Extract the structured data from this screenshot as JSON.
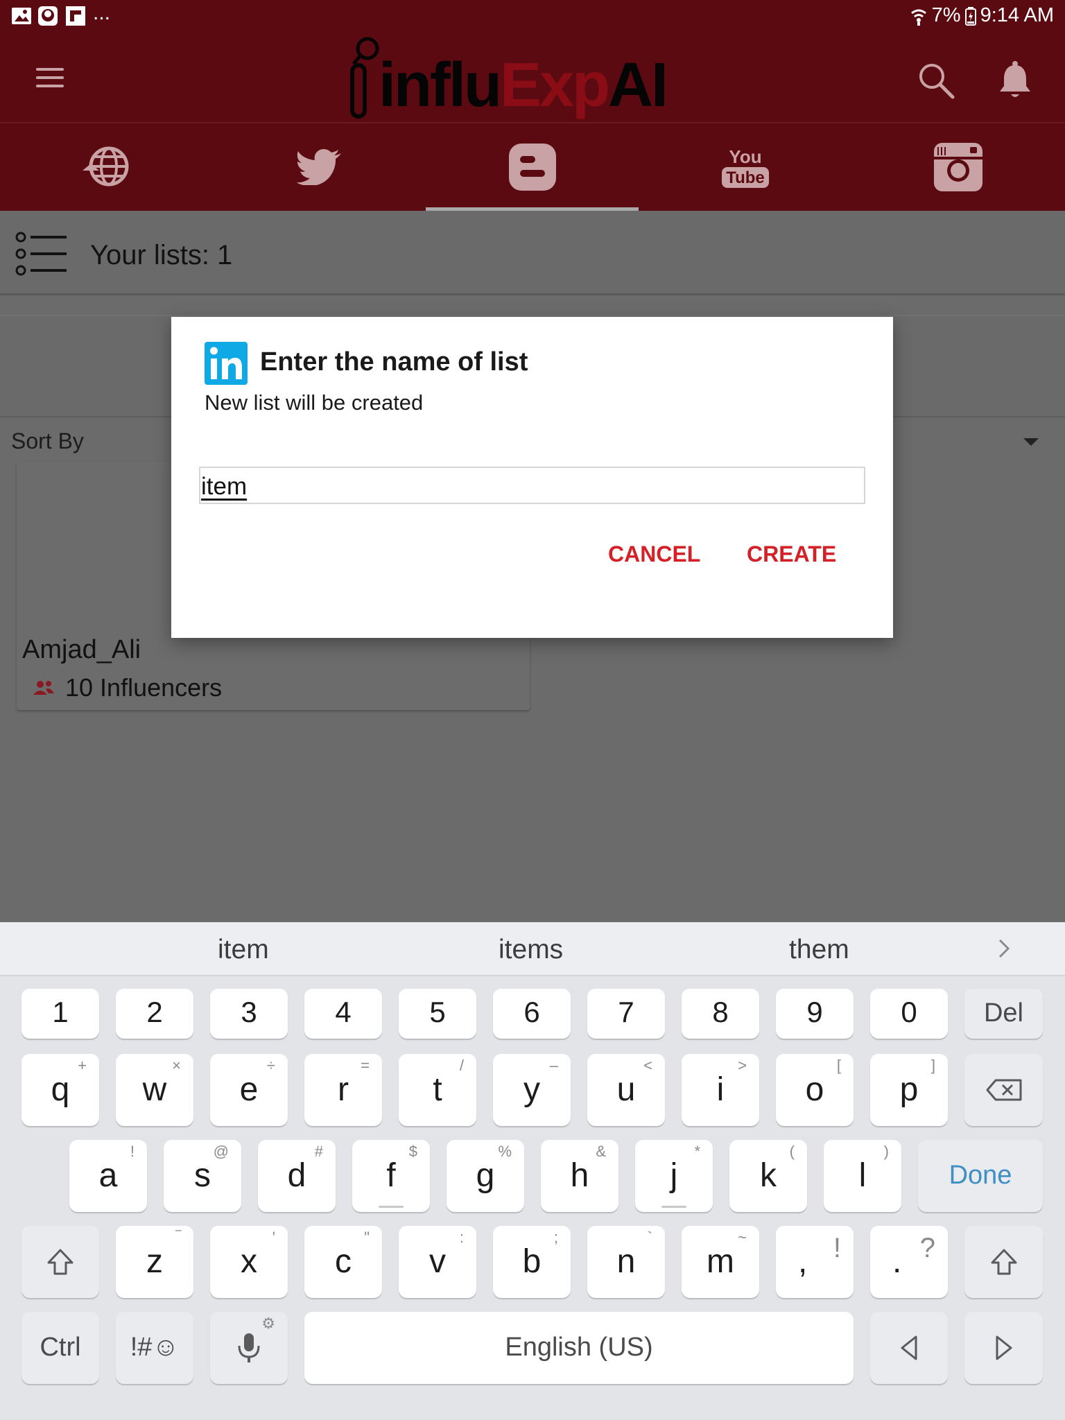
{
  "status_bar": {
    "overflow_dots": "...",
    "battery_percent": "7%",
    "time": "9:14 AM",
    "icons": [
      "gallery-icon",
      "app-notification-icon",
      "flipboard-icon",
      "wifi-icon",
      "battery-icon"
    ]
  },
  "app_bar": {
    "logo_part1": "influ",
    "logo_part2": "Exp",
    "logo_part3": "AI",
    "icons": [
      "hamburger-menu-icon",
      "search-icon",
      "bell-icon"
    ]
  },
  "tabs": [
    {
      "name": "web",
      "icon": "globe-icon"
    },
    {
      "name": "twitter",
      "icon": "twitter-icon",
      "active": false
    },
    {
      "name": "blogger",
      "icon": "blogger-icon",
      "active": true
    },
    {
      "name": "youtube",
      "icon": "youtube-icon",
      "label_top": "You",
      "label_bottom": "Tube"
    },
    {
      "name": "instagram",
      "icon": "instagram-icon"
    }
  ],
  "content": {
    "lists_title": "Your lists: 1",
    "sort_by_label": "Sort By",
    "list_card": {
      "name": "Amjad_Ali",
      "count": "10 Influencers"
    }
  },
  "dialog": {
    "title": "Enter the name of list",
    "subtitle": "New list will be created",
    "input_value": "item",
    "cancel_label": "CANCEL",
    "create_label": "CREATE",
    "icon": "linkedin-icon"
  },
  "keyboard": {
    "suggestions": [
      "item",
      "items",
      "them"
    ],
    "number_row": [
      "1",
      "2",
      "3",
      "4",
      "5",
      "6",
      "7",
      "8",
      "9",
      "0"
    ],
    "del_label": "Del",
    "row1": [
      {
        "k": "q",
        "s": "+"
      },
      {
        "k": "w",
        "s": "×"
      },
      {
        "k": "e",
        "s": "÷"
      },
      {
        "k": "r",
        "s": "="
      },
      {
        "k": "t",
        "s": "/"
      },
      {
        "k": "y",
        "s": "–"
      },
      {
        "k": "u",
        "s": "<"
      },
      {
        "k": "i",
        "s": ">"
      },
      {
        "k": "o",
        "s": "["
      },
      {
        "k": "p",
        "s": "]"
      }
    ],
    "row2": [
      {
        "k": "a",
        "s": "!"
      },
      {
        "k": "s",
        "s": "@"
      },
      {
        "k": "d",
        "s": "#"
      },
      {
        "k": "f",
        "s": "$"
      },
      {
        "k": "g",
        "s": "%"
      },
      {
        "k": "h",
        "s": "&"
      },
      {
        "k": "j",
        "s": "*"
      },
      {
        "k": "k",
        "s": "("
      },
      {
        "k": "l",
        "s": ")"
      }
    ],
    "done_label": "Done",
    "row3": [
      {
        "k": "z",
        "s": "‾"
      },
      {
        "k": "x",
        "s": "'"
      },
      {
        "k": "c",
        "s": "\""
      },
      {
        "k": "v",
        "s": ":"
      },
      {
        "k": "b",
        "s": ";"
      },
      {
        "k": "n",
        "s": "`"
      },
      {
        "k": "m",
        "s": "~"
      },
      {
        "k": ",",
        "s": "!"
      },
      {
        "k": ".",
        "s": "?"
      }
    ],
    "ctrl_label": "Ctrl",
    "symbols_label": "!#☺",
    "space_label": "English (US)",
    "accent_color": "#3d8fc4"
  },
  "colors": {
    "brand_dark_red": "#5b0a11",
    "action_red": "#d42027",
    "linkedin_blue": "#0fa9e6"
  }
}
